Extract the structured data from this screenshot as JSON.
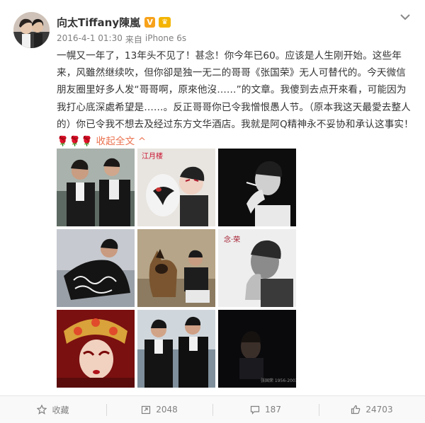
{
  "user": {
    "name": "向太Tiffany陳嵐",
    "vip_mark": "V",
    "badge_icon": "member-crown-icon"
  },
  "meta": {
    "date": "2016-4-1 01:30",
    "via": "来自",
    "device": "iPhone 6s"
  },
  "post": {
    "text": "一幌又一年了，13年头不见了！甚念！你今年已60。应该是人生刚开始。这些年来，风雖然继续吹，但你卻是独一无二的哥哥《张国荣》无人可替代的。今天微信朋友圈里好多人发“哥哥啊，原來他沒……”的文章。我傻到去点开來看，可能因为我打心底深處希望是……。反正哥哥你已令我憎恨愚人节。（原本我这天最愛去整人的）你已令我不想去及经过东方文华酒店。我就是阿Q精神永不妥协和承认这事实！",
    "roses": "🌹🌹🌹",
    "collapse_label": "收起全文",
    "collapse_icon": "caret-up-icon"
  },
  "images": [
    {
      "name": "photo-two-men-in-tuxedos"
    },
    {
      "name": "photo-opera-makeup-portrait",
      "caption": "江月楼"
    },
    {
      "name": "photo-smoking-portrait-bw"
    },
    {
      "name": "photo-stage-costume"
    },
    {
      "name": "photo-with-german-shepherd"
    },
    {
      "name": "photo-book-cover-hand-on-chin",
      "caption": "念·荣"
    },
    {
      "name": "photo-opera-headdress"
    },
    {
      "name": "photo-two-men-black-suits"
    },
    {
      "name": "photo-dark-portrait",
      "caption": "张国荣 1956-2003"
    }
  ],
  "footer": {
    "favorite_label": "收藏",
    "repost_count": "2048",
    "comment_count": "187",
    "like_count": "24703"
  },
  "colors": {
    "accent": "#eb7350",
    "text": "#333333",
    "muted": "#808080"
  }
}
